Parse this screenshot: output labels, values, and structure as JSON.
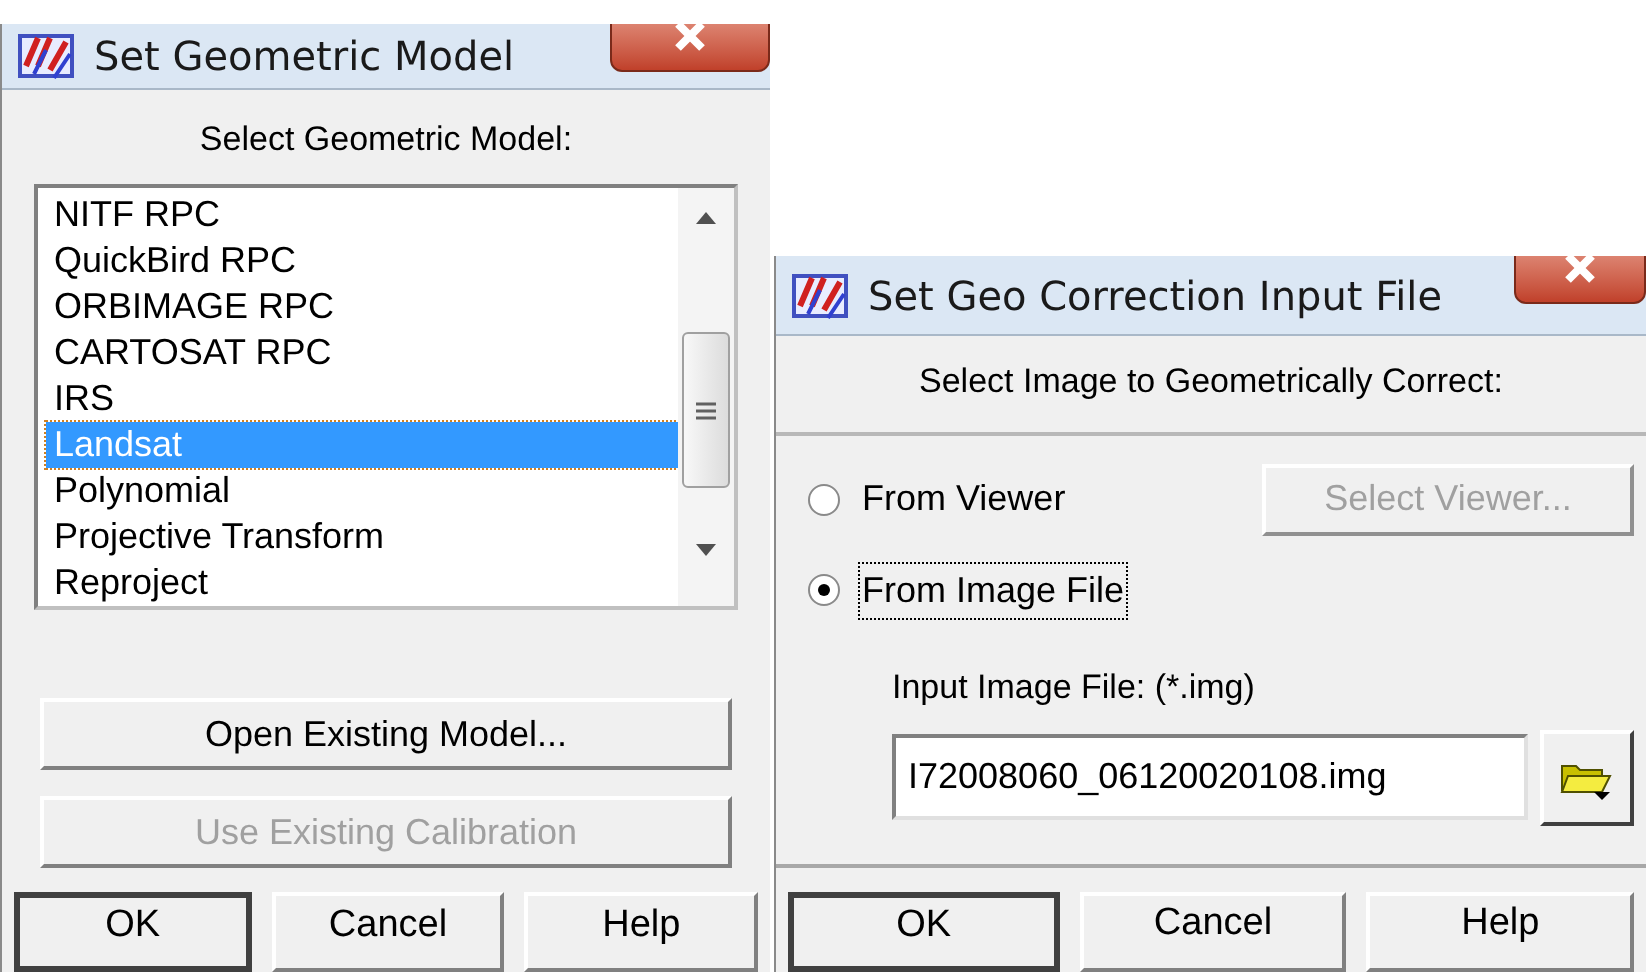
{
  "dialogs": [
    {
      "title": "Set Geometric Model",
      "heading": "Select Geometric Model:",
      "list": [
        {
          "label": "NITF RPC",
          "selected": false
        },
        {
          "label": "QuickBird RPC",
          "selected": false
        },
        {
          "label": "ORBIMAGE RPC",
          "selected": false
        },
        {
          "label": "CARTOSAT RPC",
          "selected": false
        },
        {
          "label": "IRS",
          "selected": false
        },
        {
          "label": "Landsat",
          "selected": true
        },
        {
          "label": "Polynomial",
          "selected": false
        },
        {
          "label": "Projective Transform",
          "selected": false
        },
        {
          "label": "Reproject",
          "selected": false
        }
      ],
      "buttons": [
        {
          "label": "Open Existing Model...",
          "disabled": false
        },
        {
          "label": "Use Existing Calibration",
          "disabled": true
        }
      ],
      "footer_buttons": [
        {
          "label": "OK",
          "default": true
        },
        {
          "label": "Cancel",
          "default": false
        },
        {
          "label": "Help",
          "default": false
        }
      ]
    },
    {
      "title": "Set Geo Correction Input File",
      "heading": "Select Image to Geometrically Correct:",
      "radios": [
        {
          "label": "From Viewer",
          "selected": false,
          "focused": false
        },
        {
          "label": "From Image File",
          "selected": true,
          "focused": true
        }
      ],
      "select_viewer_button": {
        "label": "Select Viewer...",
        "disabled": true
      },
      "input_label": "Input Image File: (*.img)",
      "input_value": "I72008060_06120020108.img",
      "footer_buttons": [
        {
          "label": "OK",
          "default": true
        },
        {
          "label": "Cancel",
          "default": false
        },
        {
          "label": "Help",
          "default": false
        }
      ]
    }
  ]
}
